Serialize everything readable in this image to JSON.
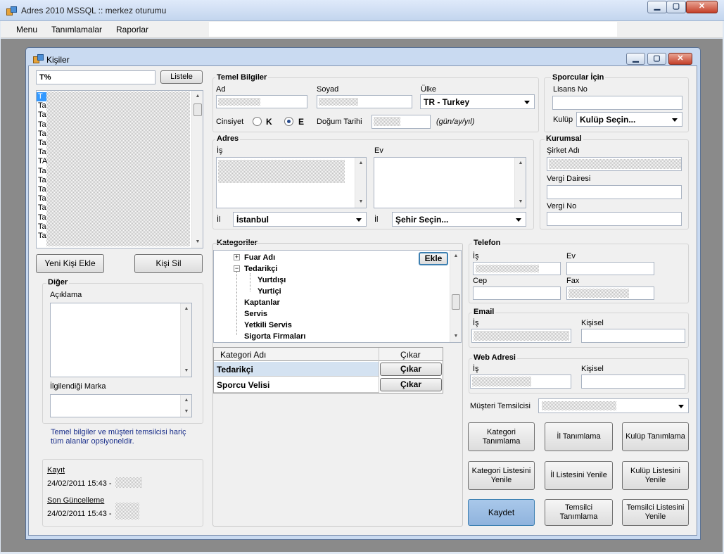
{
  "app": {
    "title": "Adres 2010 MSSQL :: merkez oturumu"
  },
  "menu": [
    "Menu",
    "Tanımlamalar",
    "Raporlar"
  ],
  "child": {
    "title": "Kişiler"
  },
  "search": {
    "value": "T%",
    "button": "Listele"
  },
  "list_items": [
    "T",
    "Ta",
    "Ta",
    "Ta",
    "Ta",
    "Ta",
    "Ta",
    "TA",
    "Ta",
    "Ta",
    "Ta",
    "Ta",
    "Ta",
    "Ta",
    "Ta",
    "Ta",
    "Ta"
  ],
  "buttons": {
    "new": "Yeni Kişi Ekle",
    "delete": "Kişi Sil",
    "add": "Ekle",
    "save": "Kaydet"
  },
  "diger": {
    "title": "Diğer",
    "aciklama": "Açıklama",
    "marka": "İlgilendiği Marka"
  },
  "note": "Temel bilgiler ve müşteri temsilcisi hariç tüm alanlar opsiyoneldir.",
  "audit": {
    "kayit_label": "Kayıt",
    "kayit_value": "24/02/2011 15:43 -",
    "guncel_label": "Son Güncelleme",
    "guncel_value": "24/02/2011 15:43 -"
  },
  "temel": {
    "title": "Temel Bilgiler",
    "ad": "Ad",
    "soyad": "Soyad",
    "ulke": "Ülke",
    "ulke_value": "TR - Turkey",
    "cinsiyet": "Cinsiyet",
    "k": "K",
    "e": "E",
    "dogum": "Doğum Tarihi",
    "format": "(gün/ay/yıl)"
  },
  "sporcu": {
    "title": "Sporcular İçin",
    "lisans": "Lisans No",
    "kulup": "Kulüp",
    "kulup_value": "Kulüp Seçin..."
  },
  "adres": {
    "title": "Adres",
    "is": "İş",
    "ev": "Ev",
    "il1": "İl",
    "il1_value": "İstanbul",
    "il2": "İl",
    "il2_value": "Şehir Seçin..."
  },
  "kurumsal": {
    "title": "Kurumsal",
    "sirket": "Şirket Adı",
    "vergi_dairesi": "Vergi Dairesi",
    "vergi_no": "Vergi No"
  },
  "kategoriler": {
    "title": "Kategoriler",
    "tree": [
      "Fuar Adı",
      "Tedarikçi",
      "Yurtdışı",
      "Yurtiçi",
      "Kaptanlar",
      "Servis",
      "Yetkili Servis",
      "Sigorta Firmaları"
    ]
  },
  "grid": {
    "col1": "Kategori Adı",
    "col2": "Çıkar",
    "rows": [
      {
        "name": "Tedarikçi",
        "action": "Çıkar"
      },
      {
        "name": "Sporcu Velisi",
        "action": "Çıkar"
      }
    ]
  },
  "telefon": {
    "title": "Telefon",
    "is": "İş",
    "ev": "Ev",
    "cep": "Cep",
    "fax": "Fax"
  },
  "email": {
    "title": "Email",
    "is": "İş",
    "kisisel": "Kişisel"
  },
  "web": {
    "title": "Web Adresi",
    "is": "İş",
    "kisisel": "Kişisel"
  },
  "musteri": {
    "label": "Müşteri Temsilcisi"
  },
  "action_buttons": {
    "kategori_tanim": "Kategori Tanımlama",
    "il_tanim": "İl Tanımlama",
    "kulup_tanim": "Kulüp Tanımlama",
    "kategori_yenile": "Kategori Listesini Yenile",
    "il_yenile": "İl Listesini Yenile",
    "kulup_yenile": "Kulüp Listesini Yenile",
    "temsilci_tanim": "Temsilci Tanımlama",
    "temsilci_yenile": "Temsilci Listesini Yenile"
  }
}
